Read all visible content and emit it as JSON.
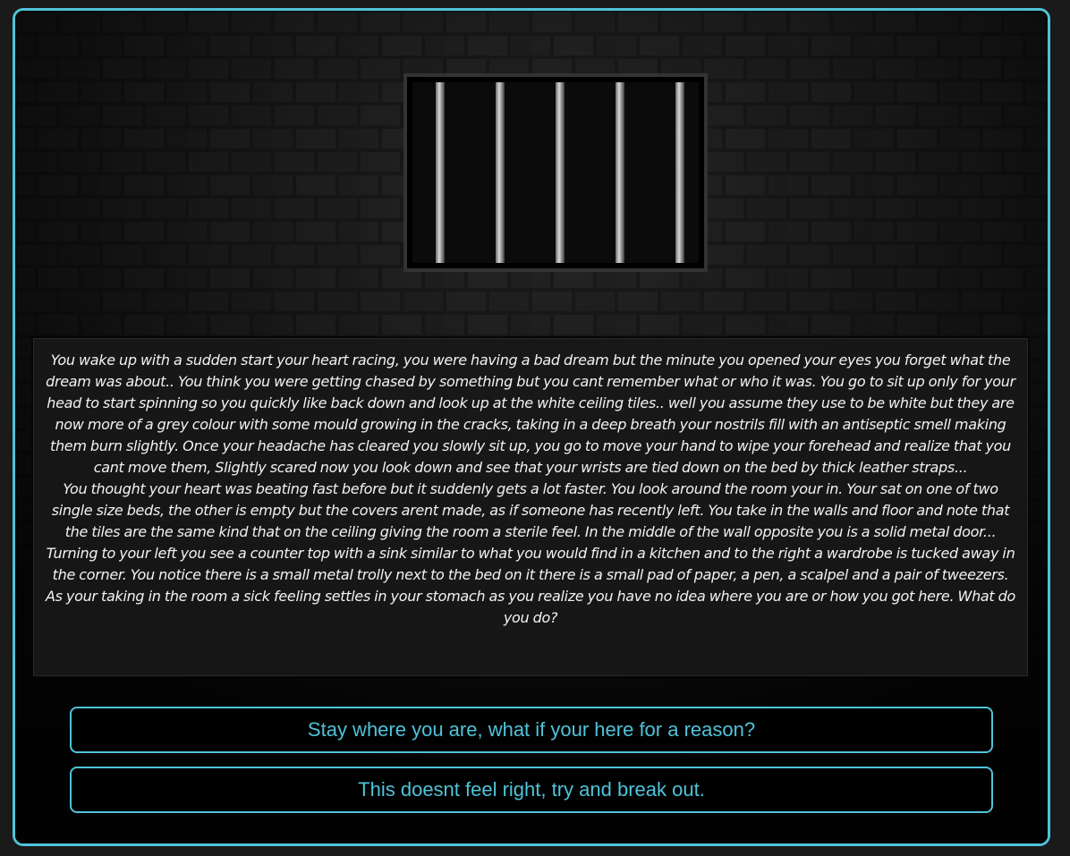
{
  "story": {
    "paragraphs": [
      "You wake up with a sudden start your heart racing, you were having a bad dream but the minute you opened your eyes you forget what the dream was about.. You think you were getting chased by something but you cant remember what or who it was. You go to sit up only for your head to start spinning so you quickly like back down and look up at the white ceiling tiles.. well you assume they use to be white but they are now more of a grey colour with some mould growing in the cracks, taking in a deep breath your nostrils fill with an antiseptic smell making them burn slightly. Once your headache has cleared you slowly sit up, you go to move your hand to wipe your forehead and realize that you cant move them, Slightly scared now you look down and see that your wrists are tied down on the bed by thick leather straps...",
      "You thought your heart was beating fast before but it suddenly gets a lot faster. You look around the room your in. Your sat on one of two single size beds, the other is empty but the covers arent made, as if someone has recently left. You take in the walls and floor and note that the tiles are the same kind that on the ceiling giving the room a sterile feel. In the middle of the wall opposite you is a solid metal door...",
      "Turning to your left you see a counter top with a sink similar to what you would find in a kitchen and to the right a wardrobe is tucked away in the corner. You notice there is a small metal trolly next to the bed on it there is a small pad of paper, a pen, a scalpel and a pair of tweezers. As your taking in the room a sick feeling settles in your stomach as you realize you have no idea where you are or how you got here. What do you do?"
    ]
  },
  "choices": [
    {
      "label": "Stay where you are, what if your here for a reason?"
    },
    {
      "label": "This doesnt feel right, try and break out."
    }
  ],
  "colors": {
    "accent": "#4fc3d9",
    "background": "#1a1a1a"
  }
}
